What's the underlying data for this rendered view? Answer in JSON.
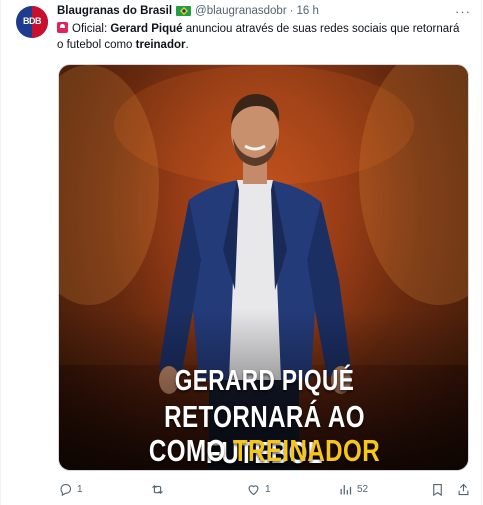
{
  "tweet": {
    "author_name": "Blaugranas do Brasil",
    "handle": "@blaugranasdobr",
    "separator": "·",
    "time": "16 h",
    "avatar_text": "BDB",
    "text": {
      "prefix": "Oficial: ",
      "subject": "Gerard Piqué",
      "middle": " anunciou através de suas redes sociais que retornará o futebol como ",
      "role": "treinador",
      "suffix": "."
    },
    "more_label": "···"
  },
  "media": {
    "headline_line1": "GERARD PIQUÉ",
    "headline_line2": "RETORNARÁ AO FUTEBOL",
    "headline_line3_prefix": "COMO ",
    "headline_line3_accent": "TREINADOR",
    "accent_color": "#f6c619"
  },
  "actions": {
    "reply_count": "1",
    "retweet_count": "",
    "like_count": "1",
    "views_count": "52",
    "icons": [
      "reply-icon",
      "retweet-icon",
      "like-icon",
      "views-icon",
      "bookmark-icon",
      "share-icon"
    ]
  }
}
